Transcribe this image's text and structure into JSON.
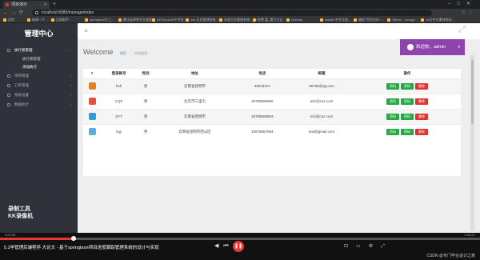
{
  "browser": {
    "tab_title": "项目演示",
    "url": "localhost:8080/manage/index",
    "bookmarks": [
      "应用",
      "新建一下",
      "比较助手",
      "springboot大三-...",
      "腾讯云视频专区搜索",
      "APICloud APP开发...",
      "vue 后台管理系统 - 2...",
      "米家后台管理系统 - 3D...",
      "免费 富_看片大全...",
      "GoEasy",
      "lodash 中文文档...",
      "编程 代码生成一...",
      "GitHub - mongo...",
      "16大中文素材网站..."
    ]
  },
  "sidebar": {
    "title": "管理中心",
    "groups": [
      {
        "label": "执行者管理",
        "open": true,
        "children": [
          "执行者管理",
          "添加执行"
        ]
      },
      {
        "label": "项目管理",
        "open": false,
        "children": []
      },
      {
        "label": "订单管理",
        "open": false,
        "children": []
      },
      {
        "label": "系统设置",
        "open": false,
        "children": []
      },
      {
        "label": "数据统计",
        "open": false,
        "children": []
      }
    ],
    "watermark_line1": "录制工具",
    "watermark_line2": "KK录像机"
  },
  "header": {
    "welcome": "Welcome",
    "crumb_home": "首页",
    "crumb_current": "/ 欢迎使用",
    "user_label": "欢迎你，admin"
  },
  "table": {
    "columns": [
      "#",
      "登录账号",
      "性别",
      "地址",
      "电话",
      "邮箱",
      "操作"
    ],
    "rows": [
      {
        "icon_color": "#e67e22",
        "account": "hsh",
        "gender": "男",
        "address": "云南省昆明市",
        "phone": "45845214",
        "email": "65786@qq.com"
      },
      {
        "icon_color": "#e74c3c",
        "account": "CQF",
        "gender": "男",
        "address": "北京市三里屯",
        "phone": "18788569865",
        "email": "a21@cuz.com"
      },
      {
        "icon_color": "#3498db",
        "account": "ZYT",
        "gender": "男",
        "address": "云南省昆明市",
        "phone": "18788569853",
        "email": "sch@cuz.com"
      },
      {
        "icon_color": "#5dade2",
        "account": "xqy",
        "gender": "男",
        "address": "云南省昆明市西山区",
        "phone": "15578587594",
        "email": "test@gmail.com"
      }
    ],
    "actions": {
      "edit": "资料",
      "pwd": "密码",
      "delete": "删除"
    }
  },
  "player": {
    "time_current": "0:09:50",
    "time_total": "0:42:07",
    "progress": 0.154,
    "video_title": "5.3学管理后端程序 大论文 - 基于springboot项目进度跟踪管理系统的设计与实现",
    "credit": "CSDN @专门毕业设计之家"
  },
  "colors": {
    "sidebar_bg": "#2f323a",
    "user_box": "#8e44ad",
    "btn_green": "#27a844",
    "btn_red": "#dd3333",
    "progress": "#e53935"
  }
}
